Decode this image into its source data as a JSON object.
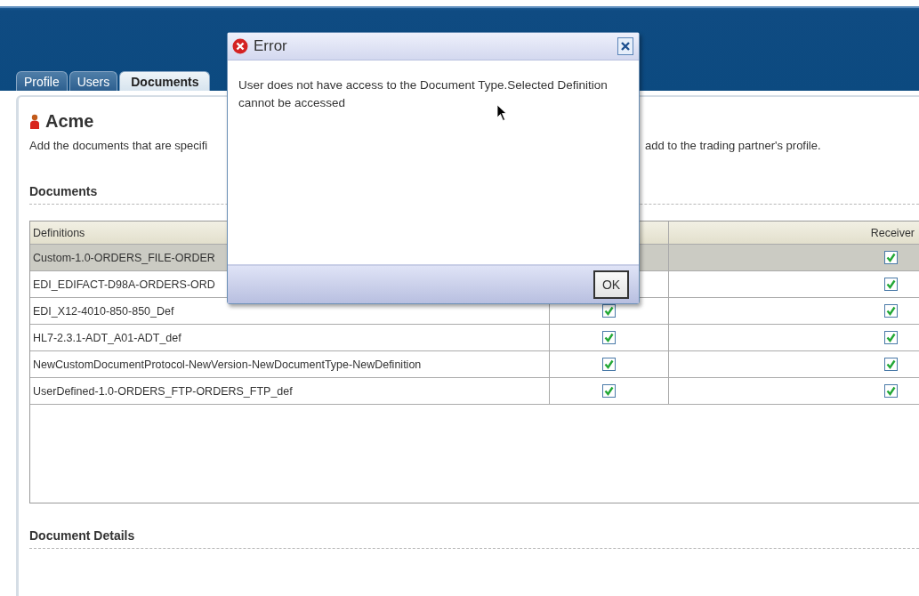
{
  "tabs": [
    {
      "label": "Profile",
      "selected": false
    },
    {
      "label": "Users",
      "selected": false
    },
    {
      "label": "Documents",
      "selected": true
    }
  ],
  "partner": {
    "name": "Acme",
    "description_left": "Add the documents that are specifi",
    "description_right": "add to the trading partner's profile."
  },
  "documents": {
    "title": "Documents",
    "headers": {
      "definitions": "Definitions",
      "receiver": "Receiver"
    },
    "rows": [
      {
        "definition": "Custom-1.0-ORDERS_FILE-ORDER",
        "selected": true,
        "receiver_checked": true
      },
      {
        "definition": "EDI_EDIFACT-D98A-ORDERS-ORD",
        "selected": false,
        "receiver_checked": true
      },
      {
        "definition": "EDI_X12-4010-850-850_Def",
        "selected": false,
        "column_2_checked": true,
        "receiver_checked": true
      },
      {
        "definition": "HL7-2.3.1-ADT_A01-ADT_def",
        "selected": false,
        "column_2_checked": true,
        "receiver_checked": true
      },
      {
        "definition": "NewCustomDocumentProtocol-NewVersion-NewDocumentType-NewDefinition",
        "selected": false,
        "column_2_checked": true,
        "receiver_checked": true
      },
      {
        "definition": "UserDefined-1.0-ORDERS_FTP-ORDERS_FTP_def",
        "selected": false,
        "column_2_checked": true,
        "receiver_checked": true
      }
    ]
  },
  "document_details": {
    "title": "Document Details"
  },
  "dialog": {
    "title": "Error",
    "message": "User does not have access to the Document Type.Selected Definition cannot be accessed",
    "buttons": [
      "OK"
    ]
  }
}
